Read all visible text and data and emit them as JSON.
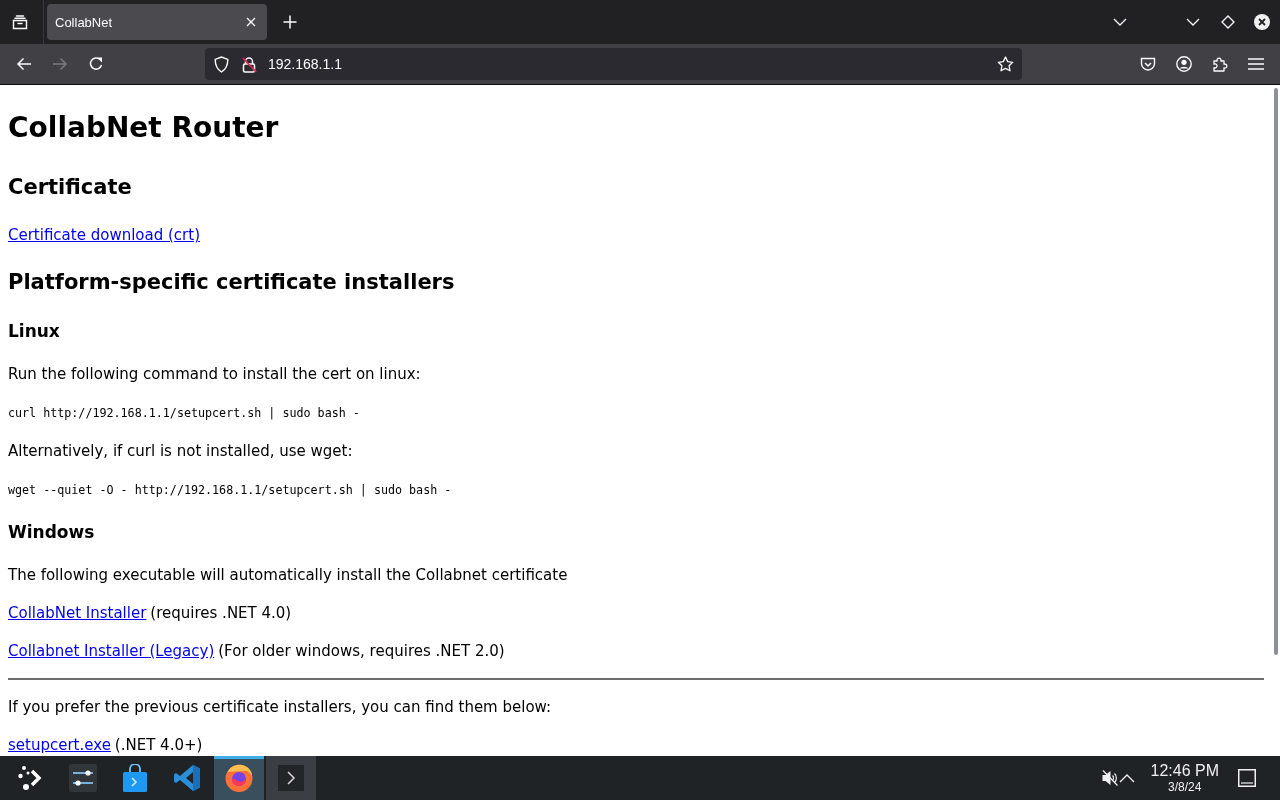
{
  "browser": {
    "tabs": [
      {
        "title": "CollabNet",
        "selected": true
      }
    ],
    "nav_buttons": [
      {
        "kind": "back",
        "disabled": false
      },
      {
        "kind": "forward",
        "disabled": true
      },
      {
        "kind": "reload",
        "disabled": false
      }
    ],
    "url": "192.168.1.1"
  },
  "page": {
    "blocks": [
      {
        "kind": "h1",
        "text": "CollabNet Router"
      },
      {
        "kind": "h2",
        "text": "Certificate"
      },
      {
        "kind": "link",
        "link": "Certificate download (crt)"
      },
      {
        "kind": "h2",
        "text": "Platform-specific certificate installers"
      },
      {
        "kind": "h3",
        "text": "Linux"
      },
      {
        "kind": "p",
        "text": "Run the following command to install the cert on linux:"
      },
      {
        "kind": "code",
        "text": "curl http://192.168.1.1/setupcert.sh | sudo bash -"
      },
      {
        "kind": "p",
        "text": "Alternatively, if curl is not installed, use wget:"
      },
      {
        "kind": "code",
        "text": "wget --quiet -O - http://192.168.1.1/setupcert.sh | sudo bash -"
      },
      {
        "kind": "h3",
        "text": "Windows"
      },
      {
        "kind": "p",
        "text": "The following executable will automatically install the Collabnet certificate"
      },
      {
        "kind": "link",
        "link": "CollabNet Installer",
        "note": "(requires .NET 4.0)"
      },
      {
        "kind": "link",
        "link": "Collabnet Installer (Legacy)",
        "note": "(For older windows, requires .NET 2.0)"
      },
      {
        "kind": "divider"
      },
      {
        "kind": "p",
        "text": "If you prefer the previous certificate installers, you can find them below:"
      },
      {
        "kind": "link",
        "link": "setupcert.exe",
        "note": "(.NET 4.0+)"
      }
    ]
  },
  "taskbar": {
    "apps": [
      {
        "kind": "launcher",
        "selected": false,
        "open": false
      },
      {
        "kind": "settings",
        "selected": false,
        "open": false
      },
      {
        "kind": "store",
        "selected": false,
        "open": false
      },
      {
        "kind": "editor",
        "selected": false,
        "open": false
      },
      {
        "kind": "browser",
        "selected": true,
        "open": true
      },
      {
        "kind": "terminal",
        "selected": false,
        "open": true
      }
    ],
    "clock": {
      "time": "12:46 PM",
      "date": "3/8/24"
    }
  }
}
